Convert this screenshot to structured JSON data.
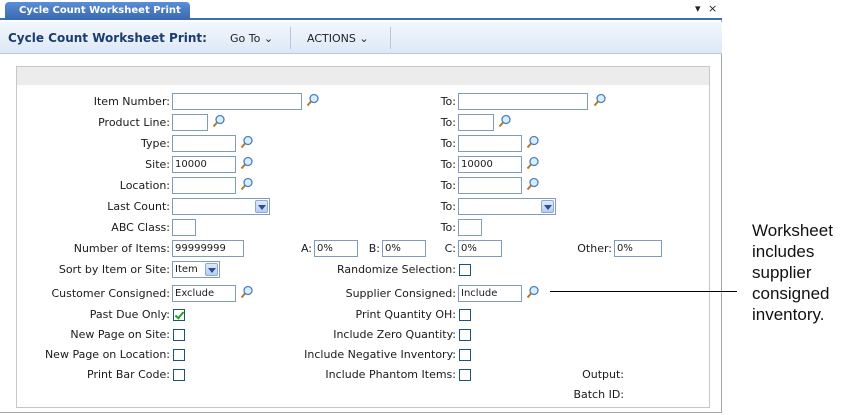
{
  "tab": {
    "label": "Cycle Count Worksheet Print"
  },
  "header": {
    "title": "Cycle Count Worksheet Print:",
    "goto": "Go To ⌄",
    "actions": "ACTIONS ⌄"
  },
  "form": {
    "item_number": {
      "label": "Item Number:",
      "value": "",
      "to_label": "To:",
      "to_value": ""
    },
    "product_line": {
      "label": "Product Line:",
      "value": "",
      "to_label": "To:",
      "to_value": ""
    },
    "type": {
      "label": "Type:",
      "value": "",
      "to_label": "To:",
      "to_value": ""
    },
    "site": {
      "label": "Site:",
      "value": "10000",
      "to_label": "To:",
      "to_value": "10000"
    },
    "location": {
      "label": "Location:",
      "value": "",
      "to_label": "To:",
      "to_value": ""
    },
    "last_count": {
      "label": "Last Count:",
      "value": "",
      "to_label": "To:",
      "to_value": ""
    },
    "abc_class": {
      "label": "ABC Class:",
      "value": "",
      "to_label": "To:",
      "to_value": ""
    },
    "number_of_items": {
      "label": "Number of Items:",
      "value": "99999999"
    },
    "a": {
      "label": "A:",
      "value": "0%"
    },
    "b": {
      "label": "B:",
      "value": "0%"
    },
    "c": {
      "label": "C:",
      "value": "0%"
    },
    "other": {
      "label": "Other:",
      "value": "0%"
    },
    "sort_by": {
      "label": "Sort by Item or Site:",
      "value": "Item"
    },
    "randomize": {
      "label": "Randomize Selection:",
      "checked": false
    },
    "customer_consigned": {
      "label": "Customer Consigned:",
      "value": "Exclude"
    },
    "supplier_consigned": {
      "label": "Supplier Consigned:",
      "value": "Include"
    },
    "past_due_only": {
      "label": "Past Due Only:",
      "checked": true
    },
    "print_quantity_oh": {
      "label": "Print Quantity OH:",
      "checked": false
    },
    "new_page_on_site": {
      "label": "New Page on Site:",
      "checked": false
    },
    "include_zero_quantity": {
      "label": "Include Zero Quantity:",
      "checked": false
    },
    "new_page_on_location": {
      "label": "New Page on Location:",
      "checked": false
    },
    "include_negative_inventory": {
      "label": "Include Negative Inventory:",
      "checked": false
    },
    "print_bar_code": {
      "label": "Print Bar Code:",
      "checked": false
    },
    "include_phantom_items": {
      "label": "Include Phantom Items:",
      "checked": false
    },
    "output": {
      "label": "Output:"
    },
    "batch_id": {
      "label": "Batch ID:"
    }
  },
  "callout": {
    "text": "Worksheet includes supplier consigned inventory."
  },
  "colors": {
    "accent": "#3d6fb5",
    "title": "#1b3c6e",
    "check": "#21a121"
  },
  "icons": {
    "lookup": "magnifier-icon",
    "dropdown": "chevron-down-icon",
    "close": "close-icon"
  }
}
